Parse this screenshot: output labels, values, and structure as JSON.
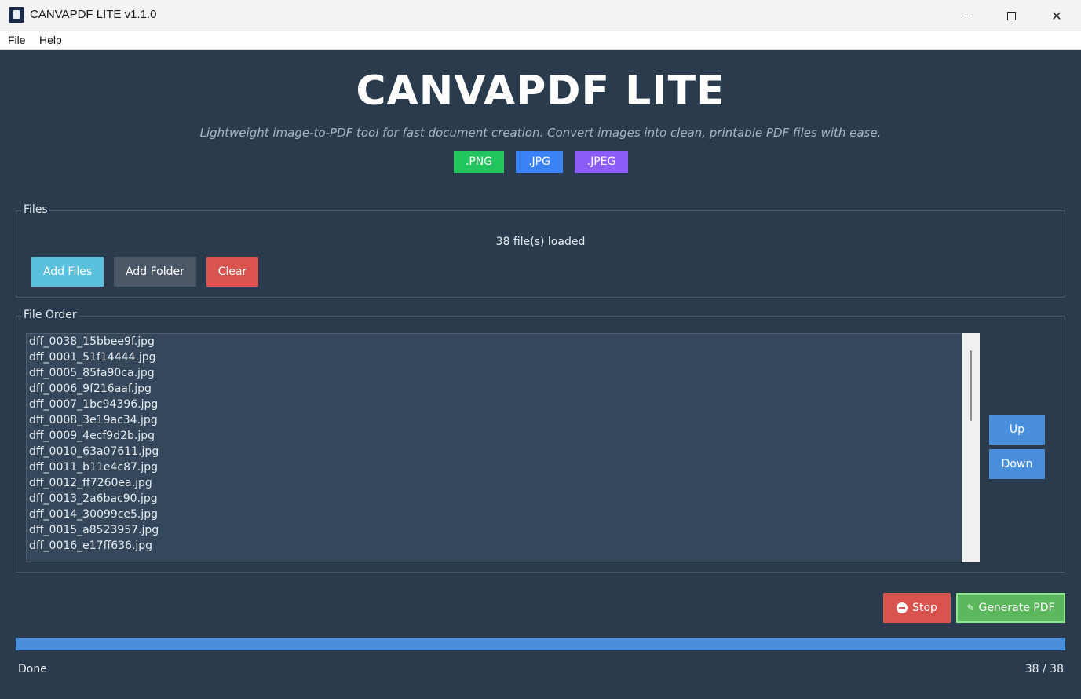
{
  "window": {
    "title": "CANVAPDF LITE v1.1.0",
    "minimize_glyph": "",
    "maximize_glyph": "",
    "close_glyph": "✕"
  },
  "menu": {
    "file": "File",
    "help": "Help"
  },
  "header": {
    "title": "CANVAPDF LITE",
    "subtitle": "Lightweight image-to-PDF tool for fast document creation. Convert images into clean, printable PDF files with ease.",
    "formats": [
      {
        "label": ".PNG",
        "color": "#22c55e"
      },
      {
        "label": ".JPG",
        "color": "#3b82f6"
      },
      {
        "label": ".JPEG",
        "color": "#8b5cf6"
      }
    ]
  },
  "files_group": {
    "label": "Files",
    "status": "38 file(s) loaded",
    "add_files_label": "Add Files",
    "add_folder_label": "Add Folder",
    "clear_label": "Clear",
    "colors": {
      "add_files": "#5bc0de",
      "add_folder": "#4b5766",
      "clear": "#d9534f"
    }
  },
  "order_group": {
    "label": "File Order",
    "files": [
      "dff_0038_15bbee9f.jpg",
      "dff_0001_51f14444.jpg",
      "dff_0005_85fa90ca.jpg",
      "dff_0006_9f216aaf.jpg",
      "dff_0007_1bc94396.jpg",
      "dff_0008_3e19ac34.jpg",
      "dff_0009_4ecf9d2b.jpg",
      "dff_0010_63a07611.jpg",
      "dff_0011_b11e4c87.jpg",
      "dff_0012_ff7260ea.jpg",
      "dff_0013_2a6bac90.jpg",
      "dff_0014_30099ce5.jpg",
      "dff_0015_a8523957.jpg",
      "dff_0016_e17ff636.jpg"
    ],
    "up_label": "Up",
    "down_label": "Down",
    "move_color": "#4a8fdb"
  },
  "actions": {
    "stop_label": "Stop",
    "stop_icon": "stop-icon",
    "generate_label": "Generate PDF",
    "generate_icon": "pen-icon",
    "colors": {
      "stop": "#d9534f",
      "generate": "#5cb85c"
    }
  },
  "progress": {
    "fraction": 1.0,
    "status": "Done",
    "count": "38 / 38",
    "color": "#4a8fdb"
  }
}
